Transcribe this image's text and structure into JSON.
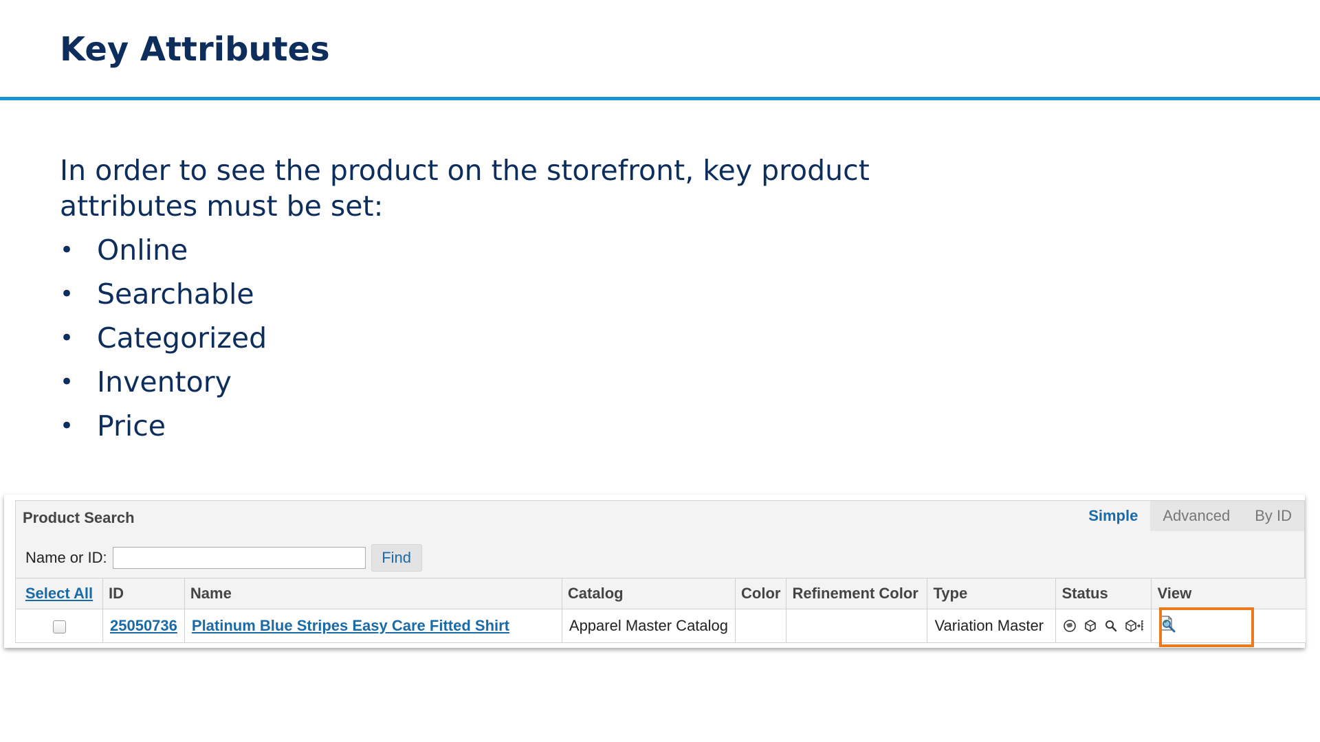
{
  "slide": {
    "title": "Key Attributes",
    "intro": "In order to see the product on the storefront, key product attributes must be set:",
    "bullets": [
      "Online",
      "Searchable",
      "Categorized",
      "Inventory",
      "Price"
    ]
  },
  "product_search": {
    "title": "Product Search",
    "tabs": [
      "Simple",
      "Advanced",
      "By ID"
    ],
    "active_tab": "Simple",
    "search_label": "Name or ID:",
    "search_value": "",
    "find_label": "Find",
    "columns": [
      "Select All",
      "ID",
      "Name",
      "Catalog",
      "Color",
      "Refinement Color",
      "Type",
      "Status",
      "View"
    ],
    "rows": [
      {
        "id": "25050736",
        "name": "Platinum Blue Stripes Easy Care Fitted Shirt",
        "catalog": "Apparel Master Catalog",
        "color": "",
        "refinement_color": "",
        "type": "Variation Master",
        "status_icons": [
          "online-icon",
          "category-icon",
          "searchable-icon",
          "inventory-icon"
        ],
        "view_icon": "view-icon",
        "selected": false
      }
    ]
  },
  "colors": {
    "title": "#0d2d5c",
    "rule": "#1a93d2",
    "link": "#1a6aa8",
    "highlight": "#ea7a1c"
  }
}
